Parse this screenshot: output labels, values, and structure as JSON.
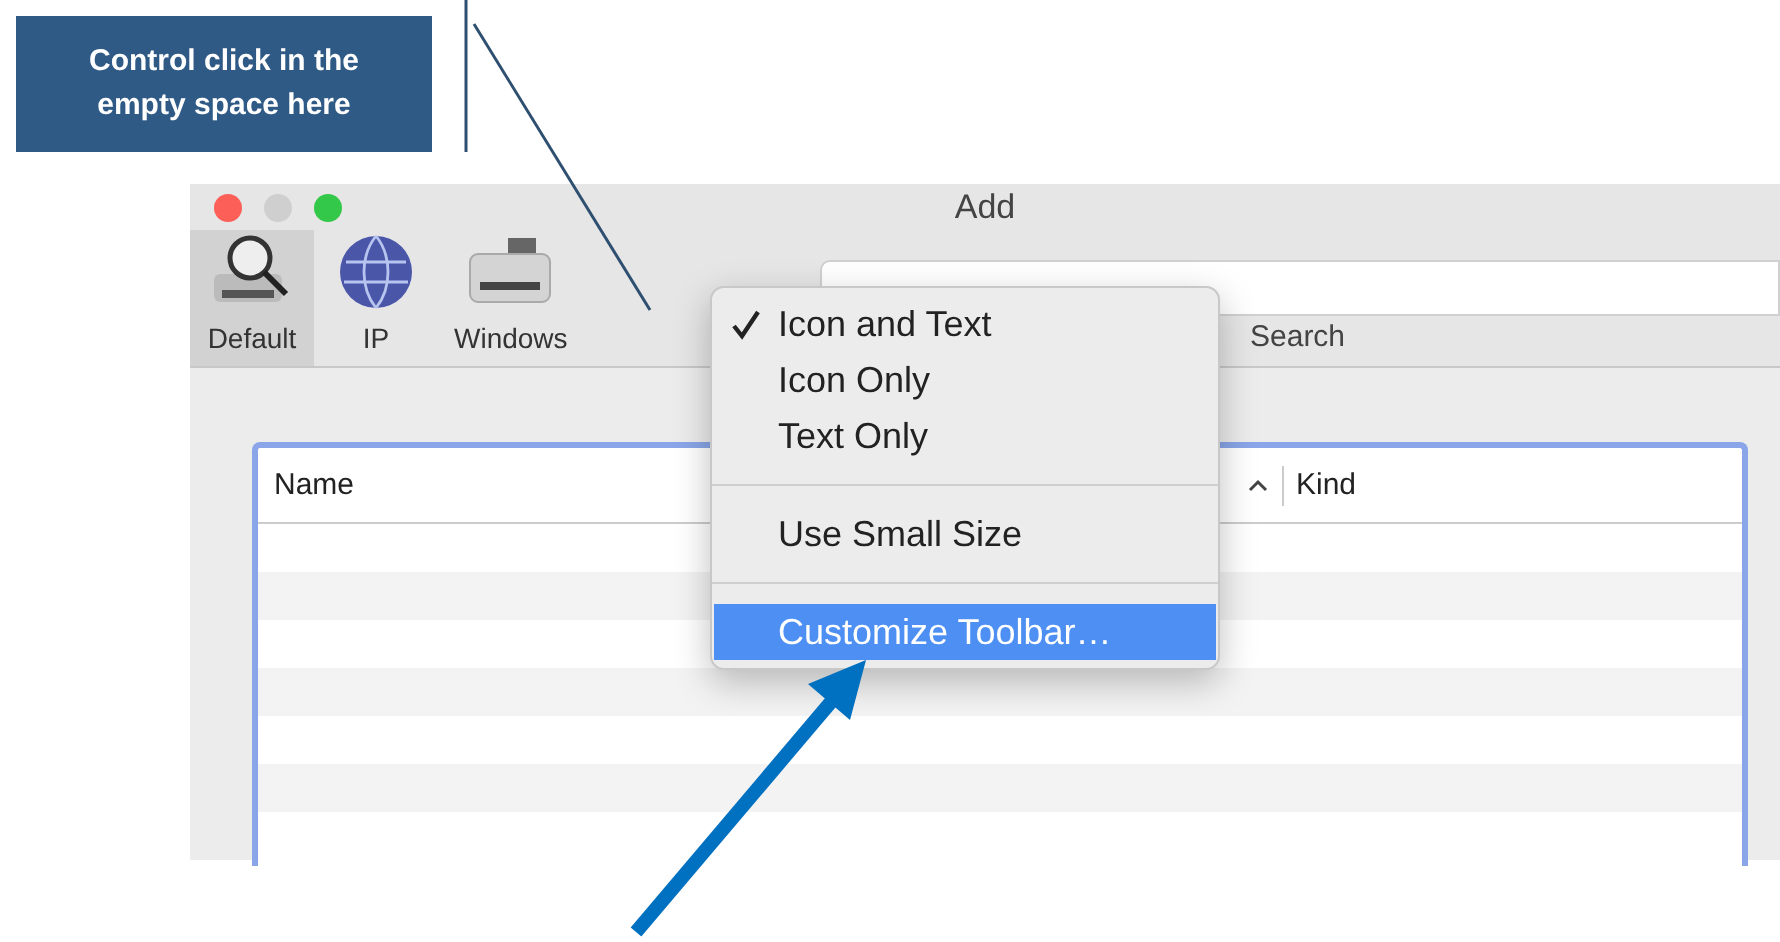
{
  "callout": {
    "text": "Control click in the empty space here"
  },
  "window": {
    "title": "Add"
  },
  "toolbar": {
    "items": [
      {
        "label": "Default",
        "kind": "magnifier",
        "selected": true
      },
      {
        "label": "IP",
        "kind": "globe",
        "selected": false
      },
      {
        "label": "Windows",
        "kind": "printer",
        "selected": false
      }
    ],
    "search_label": "Search"
  },
  "table": {
    "columns": [
      {
        "label": "Name"
      },
      {
        "label": "Kind"
      }
    ]
  },
  "context_menu": {
    "items": [
      {
        "kind": "option",
        "label": "Icon and Text",
        "checked": true,
        "selected": false
      },
      {
        "kind": "option",
        "label": "Icon Only",
        "checked": false,
        "selected": false
      },
      {
        "kind": "option",
        "label": "Text Only",
        "checked": false,
        "selected": false
      },
      {
        "kind": "separator"
      },
      {
        "kind": "option",
        "label": "Use Small Size",
        "checked": false,
        "selected": false
      },
      {
        "kind": "separator"
      },
      {
        "kind": "option",
        "label": "Customize Toolbar…",
        "checked": false,
        "selected": true
      }
    ]
  }
}
